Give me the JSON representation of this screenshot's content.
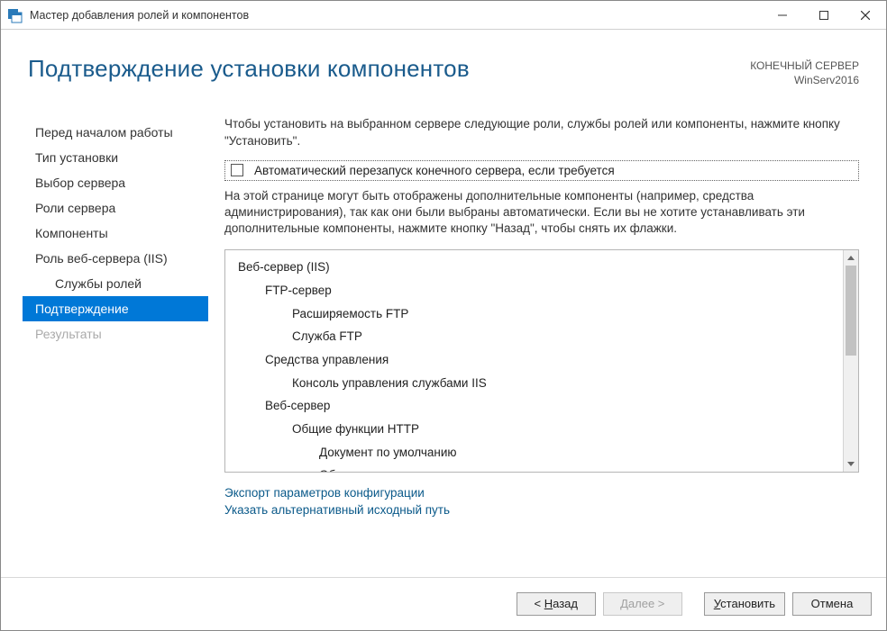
{
  "titlebar": {
    "window_title": "Мастер добавления ролей и компонентов"
  },
  "header": {
    "page_title": "Подтверждение установки компонентов",
    "server_label": "КОНЕЧНЫЙ СЕРВЕР",
    "server_name": "WinServ2016"
  },
  "sidebar": {
    "items": [
      {
        "label": "Перед началом работы",
        "state": "normal"
      },
      {
        "label": "Тип установки",
        "state": "normal"
      },
      {
        "label": "Выбор сервера",
        "state": "normal"
      },
      {
        "label": "Роли сервера",
        "state": "normal"
      },
      {
        "label": "Компоненты",
        "state": "normal"
      },
      {
        "label": "Роль веб-сервера (IIS)",
        "state": "normal"
      },
      {
        "label": "Службы ролей",
        "state": "normal",
        "sub": true
      },
      {
        "label": "Подтверждение",
        "state": "selected"
      },
      {
        "label": "Результаты",
        "state": "disabled"
      }
    ]
  },
  "content": {
    "intro": "Чтобы установить на выбранном сервере следующие роли, службы ролей или компоненты, нажмите кнопку \"Установить\".",
    "restart_checkbox_label": "Автоматический перезапуск конечного сервера, если требуется",
    "note": "На этой странице могут быть отображены дополнительные компоненты (например, средства администрирования), так как они были выбраны автоматически. Если вы не хотите устанавливать эти дополнительные компоненты, нажмите кнопку \"Назад\", чтобы снять их флажки.",
    "tree": [
      {
        "level": 0,
        "label": "Веб-сервер (IIS)"
      },
      {
        "level": 1,
        "label": "FTP-сервер"
      },
      {
        "level": 2,
        "label": "Расширяемость FTP"
      },
      {
        "level": 2,
        "label": "Служба FTP"
      },
      {
        "level": 1,
        "label": "Средства управления"
      },
      {
        "level": 2,
        "label": "Консоль управления службами IIS"
      },
      {
        "level": 1,
        "label": "Веб-сервер"
      },
      {
        "level": 2,
        "label": "Общие функции HTTP"
      },
      {
        "level": 3,
        "label": "Документ по умолчанию"
      },
      {
        "level": 3,
        "label": "Обзор каталога"
      }
    ],
    "link_export": "Экспорт параметров конфигурации",
    "link_altpath": "Указать альтернативный исходный путь"
  },
  "footer": {
    "back_prefix": "< ",
    "back_letter": "Н",
    "back_rest": "азад",
    "next_letter": "Д",
    "next_rest": "алее >",
    "install_letter": "У",
    "install_rest": "становить",
    "cancel": "Отмена"
  }
}
